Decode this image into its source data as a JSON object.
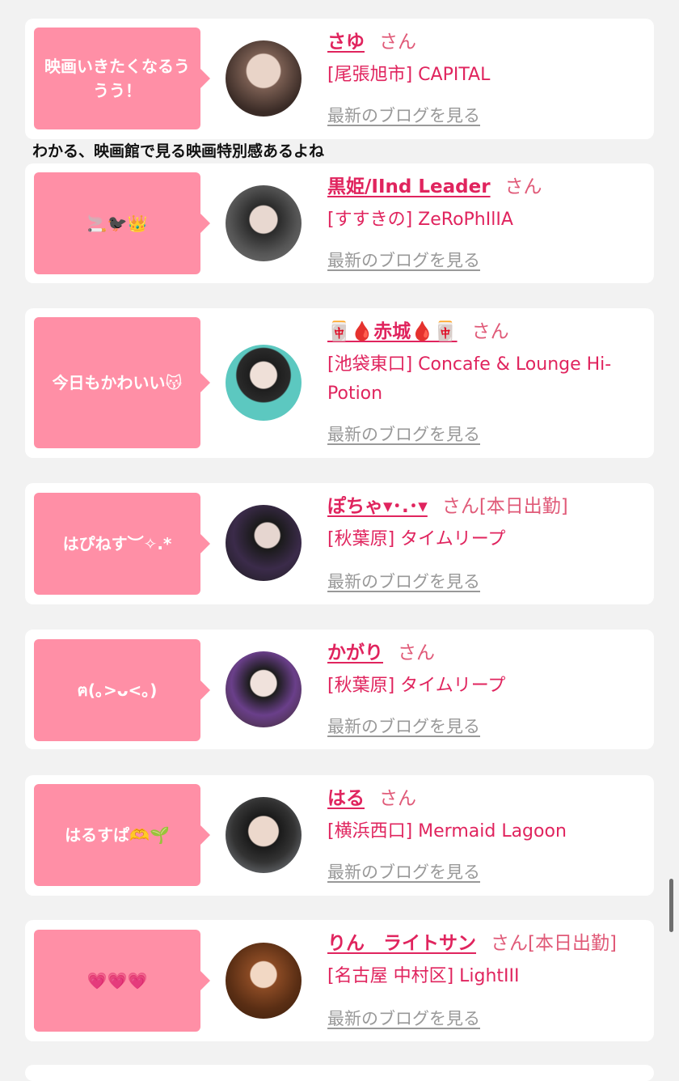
{
  "comment_text": "わかる、映画館で見る映画特別感あるよね",
  "blog_label": "最新のブログを見る",
  "san_label": "さん",
  "cards": [
    {
      "bubble": "映画いきたくなるううう！",
      "name": "さゆ",
      "status": "",
      "shop": "[尾張旭市] CAPITAL"
    },
    {
      "bubble": "🚬🐦‍⬛👑",
      "name": "黒姫/IInd Leader",
      "status": "",
      "shop": "[すすきの] ZeRoPhIlIA"
    },
    {
      "bubble": "今日もかわいい😽",
      "name": "🀄🩸赤城🩸🀄",
      "status": "",
      "shop": "[池袋東口] Concafe & Lounge Hi-Potion"
    },
    {
      "bubble": "はぴねす︶✧.*",
      "name": "ぽちゃ▾･.･▾",
      "status": "[本日出勤]",
      "shop": "[秋葉原] タイムリープ"
    },
    {
      "bubble": "ฅ(｡>ᴗ<｡)",
      "name": "かがり",
      "status": "",
      "shop": "[秋葉原] タイムリープ"
    },
    {
      "bubble": "はるすぱ🫶🌱",
      "name": "はる",
      "status": "",
      "shop": "[横浜西口] Mermaid Lagoon"
    },
    {
      "bubble": "💗💗💗",
      "name": "りん　ライトサン",
      "status": "[本日出勤]",
      "shop": "[名古屋 中村区] LightIII"
    }
  ]
}
